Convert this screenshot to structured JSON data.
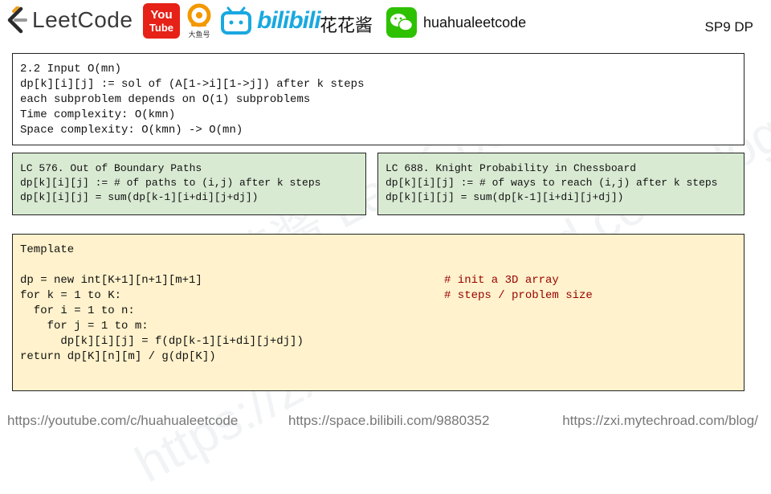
{
  "header": {
    "leetcode_text": "LeetCode",
    "youtube_line1": "You",
    "youtube_line2": "Tube",
    "dayu_label": "大鱼号",
    "bili_text": "bilibili",
    "chinese_name": "花花酱",
    "wechat_name": "huahualeetcode",
    "tag": "SP9 DP"
  },
  "box_complexity": {
    "lines": [
      "2.2 Input O(mn)",
      "dp[k][i][j] := sol of (A[1->i][1->j]) after k steps",
      "each subproblem depends on O(1) subproblems",
      "Time complexity: O(kmn)",
      "Space complexity: O(kmn) -> O(mn)"
    ]
  },
  "box_lc576": {
    "lines": [
      "LC 576. Out of Boundary Paths",
      "dp[k][i][j] := # of paths to (i,j) after k steps",
      "dp[k][i][j] = sum(dp[k-1][i+di][j+dj])"
    ]
  },
  "box_lc688": {
    "lines": [
      "LC 688. Knight Probability in Chessboard",
      "dp[k][i][j] := # of ways to reach (i,j) after k steps",
      "dp[k][i][j] = sum(dp[k-1][i+di][j+dj])"
    ]
  },
  "box_template": {
    "title": "Template",
    "code": [
      "dp = new int[K+1][n+1][m+1]",
      "for k = 1 to K:",
      "  for i = 1 to n:",
      "    for j = 1 to m:",
      "      dp[k][i][j] = f(dp[k-1][i+di][j+dj])",
      "return dp[K][n][m] / g(dp[K])"
    ],
    "comments": [
      "# init a 3D array",
      "# steps / problem size"
    ]
  },
  "watermarks": [
    "花花酱 LeetCode",
    "https://zxi.mytechroad.com/blog/"
  ],
  "footer": {
    "youtube_url": "https://youtube.com/c/huahualeetcode",
    "bilibili_url": "https://space.bilibili.com/9880352",
    "blog_url": "https://zxi.mytechroad.com/blog/"
  },
  "colors": {
    "green_box": "#d9ead3",
    "yellow_box": "#fff2cc",
    "comment": "#990000",
    "youtube_red": "#e62117",
    "bilibili_blue": "#19a8e0",
    "wechat_green": "#2dc100"
  }
}
